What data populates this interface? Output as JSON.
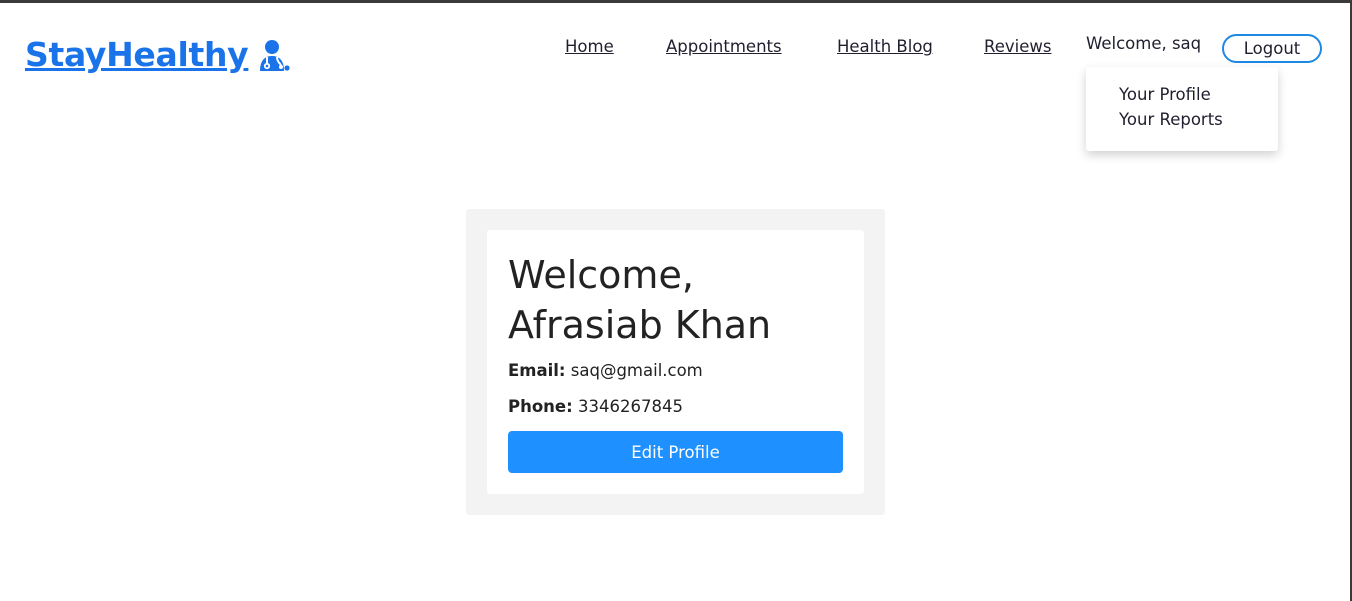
{
  "brand": {
    "name": "StayHealthy",
    "icon": "doctor-icon",
    "color": "#1a73e8"
  },
  "nav": {
    "home": "Home",
    "appointments": "Appointments",
    "health_blog": "Health Blog",
    "reviews": "Reviews",
    "welcome_user": "Welcome, saq",
    "logout": "Logout"
  },
  "dropdown": {
    "items": [
      {
        "label": "Your Profile"
      },
      {
        "label": "Your Reports"
      }
    ]
  },
  "profile": {
    "greeting_line1": "Welcome,",
    "greeting_line2": "Afrasiab Khan",
    "email_label": "Email:",
    "email_value": "saq@gmail.com",
    "phone_label": "Phone:",
    "phone_value": "3346267845",
    "edit_button": "Edit Profile",
    "button_color": "#1e90ff"
  }
}
